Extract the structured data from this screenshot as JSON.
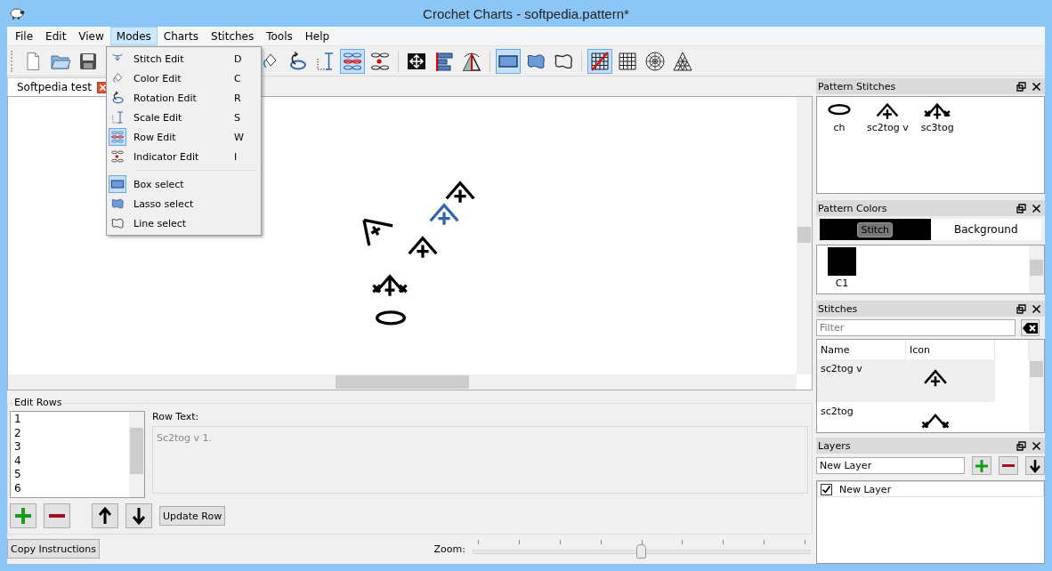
{
  "window": {
    "title": "Crochet Charts - softpedia.pattern*"
  },
  "menu": [
    {
      "label": "File",
      "selected": false
    },
    {
      "label": "Edit",
      "selected": false
    },
    {
      "label": "View",
      "selected": false
    },
    {
      "label": "Modes",
      "selected": true
    },
    {
      "label": "Charts",
      "selected": false
    },
    {
      "label": "Stitches",
      "selected": false
    },
    {
      "label": "Tools",
      "selected": false
    },
    {
      "label": "Help",
      "selected": false
    }
  ],
  "toolbar": {
    "groups": [
      [
        {
          "kind": "new",
          "selected": false
        },
        {
          "kind": "open",
          "selected": false
        },
        {
          "kind": "save",
          "selected": false
        }
      ],
      [
        {
          "kind": "color",
          "selected": false
        },
        {
          "kind": "rotation",
          "selected": false
        },
        {
          "kind": "scale",
          "selected": false
        },
        {
          "kind": "row",
          "selected": true
        },
        {
          "kind": "indicator",
          "selected": false
        }
      ],
      [
        {
          "kind": "fit",
          "selected": false
        },
        {
          "kind": "align",
          "selected": false
        },
        {
          "kind": "mirror",
          "selected": false
        }
      ],
      [
        {
          "kind": "box",
          "selected": true
        },
        {
          "kind": "lasso",
          "selected": false
        },
        {
          "kind": "line",
          "selected": false
        }
      ],
      [
        {
          "kind": "gridslash",
          "selected": true
        },
        {
          "kind": "grid",
          "selected": false
        },
        {
          "kind": "polar",
          "selected": false
        },
        {
          "kind": "triangle",
          "selected": false
        }
      ]
    ]
  },
  "modes_menu": {
    "sections": [
      [
        {
          "kind": "stitch",
          "label": "Stitch Edit",
          "shortcut": "D",
          "checked": false
        },
        {
          "kind": "color",
          "label": "Color Edit",
          "shortcut": "C",
          "checked": false
        },
        {
          "kind": "rotation",
          "label": "Rotation Edit",
          "shortcut": "R",
          "checked": false
        },
        {
          "kind": "scale",
          "label": "Scale Edit",
          "shortcut": "S",
          "checked": false
        },
        {
          "kind": "row",
          "label": "Row Edit",
          "shortcut": "W",
          "checked": true
        },
        {
          "kind": "indicator",
          "label": "Indicator Edit",
          "shortcut": "I",
          "checked": false
        }
      ],
      [
        {
          "kind": "box",
          "label": "Box select",
          "checked": true
        },
        {
          "kind": "lasso",
          "label": "Lasso select",
          "checked": false
        },
        {
          "kind": "line",
          "label": "Line select",
          "checked": false
        }
      ]
    ]
  },
  "document_tab": {
    "label": "Softpedia test"
  },
  "canvas": {
    "stitches": [
      {
        "kind": "sc2tog_v",
        "selected": false
      },
      {
        "kind": "sc2tog_v",
        "selected": true
      },
      {
        "kind": "sc2tog_v",
        "selected": false
      },
      {
        "kind": "angle_x",
        "selected": false
      },
      {
        "kind": "sc3tog",
        "selected": false
      },
      {
        "kind": "ch",
        "selected": false
      }
    ]
  },
  "edit_rows": {
    "title": "Edit Rows",
    "rows": [
      "1",
      "2",
      "3",
      "4",
      "5",
      "6"
    ],
    "row_text_label": "Row Text:",
    "row_text": "Sc2tog v 1.",
    "update_button": "Update Row"
  },
  "bottom_bar": {
    "copy_button": "Copy Instructions",
    "zoom_label": "Zoom:",
    "zoom": {
      "level": 0.5
    }
  },
  "pattern_stitches": {
    "title": "Pattern Stitches",
    "items": [
      {
        "kind": "ch",
        "label": "ch"
      },
      {
        "kind": "sc2tog_v",
        "label": "sc2tog v"
      },
      {
        "kind": "sc3tog",
        "label": "sc3tog"
      }
    ]
  },
  "pattern_colors": {
    "title": "Pattern Colors",
    "stitch": {
      "label": "Stitch",
      "color": "#000000"
    },
    "background": {
      "label": "Background",
      "color": "#ffffff"
    },
    "swatches": [
      {
        "label": "C1",
        "color": "#000000"
      }
    ]
  },
  "stitches": {
    "title": "Stitches",
    "filter_placeholder": "Filter",
    "columns": [
      "Name",
      "Icon"
    ],
    "rows": [
      {
        "name": "sc2tog v",
        "kind": "sc2tog_v",
        "selected": true
      },
      {
        "name": "sc2tog",
        "kind": "sc2tog",
        "selected": false
      }
    ]
  },
  "layers": {
    "title": "Layers",
    "name_value": "New Layer",
    "items": [
      {
        "label": "New Layer",
        "checked": true
      }
    ]
  }
}
